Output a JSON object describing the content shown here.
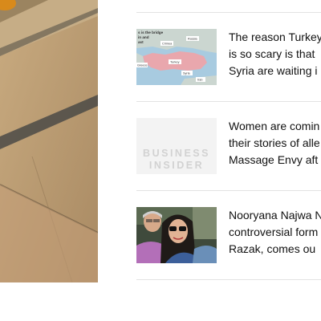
{
  "articles": [
    {
      "lines": [
        "The reason Turkey's",
        "is so scary is that",
        "Syria are waiting i"
      ],
      "thumb": "map",
      "map_labels": {
        "caption": [
          "s is the bridge",
          "in and",
          "ast"
        ],
        "russia": "Russia",
        "crimea": "Crimea",
        "greece": "Greece",
        "turkey": "Turkey",
        "syria": "Syria",
        "iran": "Iran"
      }
    },
    {
      "lines": [
        "Women are comin",
        "their stories of alle",
        "Massage Envy aft"
      ],
      "thumb": "placeholder",
      "placeholder_words": [
        "BUSINESS",
        "INSIDER"
      ]
    },
    {
      "lines": [
        "Nooryana Najwa N",
        "controversial form",
        "Razak, comes ou"
      ],
      "thumb": "photo"
    }
  ],
  "colors": {
    "map_land": "#cbd6d0",
    "map_highlight": "#e9a7ad",
    "map_sea": "#a8cbe0",
    "divider": "#e3e3e3"
  }
}
